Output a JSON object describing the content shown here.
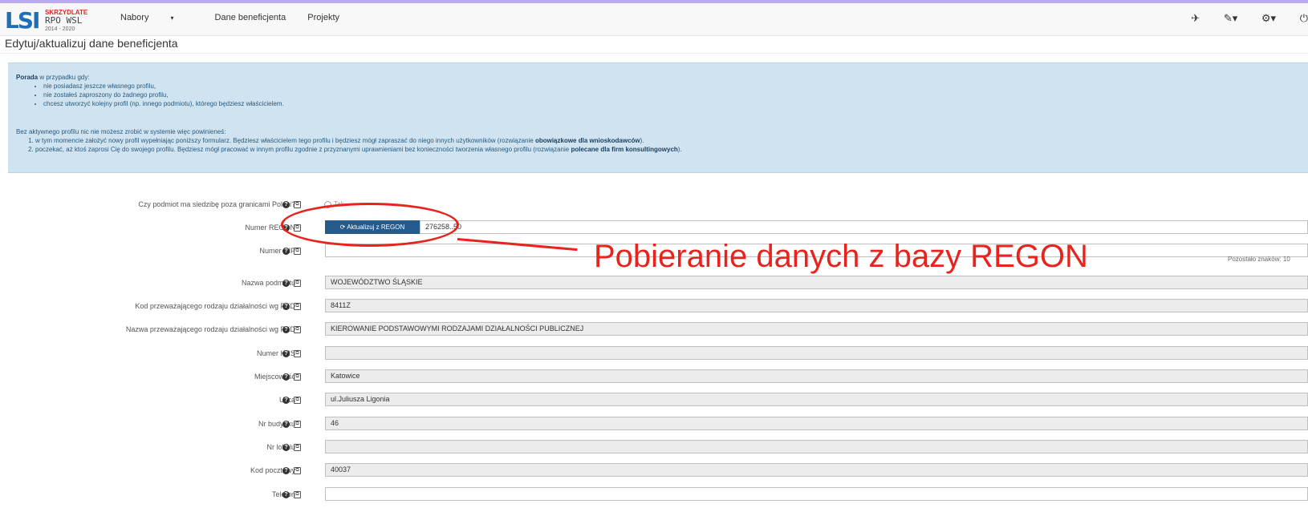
{
  "brand": {
    "logo_text": "LSI",
    "tag": "SKRZYDLATE",
    "rpo": "RPO WSL",
    "years": "2014 - 2020"
  },
  "nav": {
    "items": [
      {
        "label": "Nabory",
        "caret": "▾"
      },
      {
        "label": "Dane beneficjenta"
      },
      {
        "label": "Projekty"
      }
    ],
    "icons": [
      "help-icon",
      "wrench-icon",
      "gear-icon",
      "power-icon"
    ],
    "icon_glyphs": [
      "✈",
      "✎▾",
      "⚙▾",
      "⏻"
    ]
  },
  "page": {
    "title": "Edytuj/aktualizuj dane beneficjenta"
  },
  "alert": {
    "intro_bold": "Porada",
    "intro_rest": " w przypadku gdy:",
    "bullets": [
      "nie posiadasz jeszcze własnego profilu,",
      "nie zostałeś zaproszony do żadnego profilu,",
      "chcesz utworzyć kolejny profil (np. innego podmiotu), którego będziesz właścicielem."
    ],
    "para2": "Bez aktywnego profilu nic nie możesz zrobić w systemie więc powinieneś:",
    "steps": [
      {
        "text": "w tym momencie założyć nowy profil wypełniając poniższy formularz. Będziesz właścicielem tego profilu i będziesz mógł zapraszać do niego innych użytkowników (rozwiązanie ",
        "bold": "obowiązkowe dla wnioskodawców",
        "end": ")."
      },
      {
        "text": "poczekać, aż ktoś zaprosi Cię do swojego profilu. Będziesz mógł pracować w innym profilu zgodnie z przyznanymi uprawnieniami bez konieczności tworzenia własnego profilu (rozwiązanie ",
        "bold": "polecane dla firm konsultingowych",
        "end": ")."
      }
    ]
  },
  "form": {
    "foreign": {
      "label": "Czy podmiot ma siedzibę poza granicami Polski?",
      "option": "Tak"
    },
    "regon": {
      "label": "Numer REGON",
      "button": "⟳ Aktualizuj z REGON",
      "value": "276258..50"
    },
    "nip": {
      "label": "Numer NIP",
      "value": "",
      "side": "Pozostało znaków: 10"
    },
    "name": {
      "label": "Nazwa podmiotu",
      "value": "WOJEWÓDZTWO ŚLĄSKIE"
    },
    "pkd_code": {
      "label": "Kod przeważającego rodzaju działalności wg PKD",
      "value": "8411Z"
    },
    "pkd_name": {
      "label": "Nazwa przeważającego rodzaju działalności wg PKD",
      "value": "KIEROWANIE PODSTAWOWYMI RODZAJAMI DZIAŁALNOŚCI PUBLICZNEJ"
    },
    "krs": {
      "label": "Numer KRS",
      "value": ""
    },
    "city": {
      "label": "Miejscowość",
      "value": "Katowice"
    },
    "street": {
      "label": "Ulica",
      "value": "ul.Juliusza Ligonia"
    },
    "building": {
      "label": "Nr budynku",
      "value": "46"
    },
    "apartment": {
      "label": "Nr lokalu",
      "value": ""
    },
    "postal": {
      "label": "Kod pocztowy",
      "value": "40037"
    },
    "phone": {
      "label": "Telefon",
      "value": ""
    }
  },
  "annotation": {
    "text": "Pobieranie danych z bazy REGON",
    "color": "#e8231d"
  }
}
